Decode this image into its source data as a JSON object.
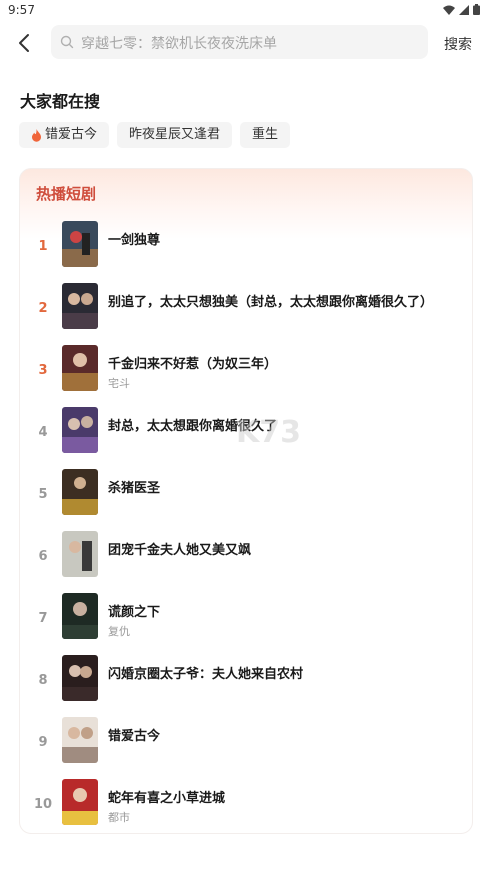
{
  "status_bar": {
    "time": "9:57"
  },
  "search": {
    "back_icon": "back-arrow-icon",
    "placeholder": "穿越七零：禁欲机长夜夜洗床单",
    "button_label": "搜索"
  },
  "trending": {
    "title": "大家都在搜",
    "tags": [
      {
        "label": "错爱古今",
        "hot": true
      },
      {
        "label": "昨夜星辰又逢君",
        "hot": false
      },
      {
        "label": "重生",
        "hot": false
      }
    ]
  },
  "hot_dramas": {
    "title": "热播短剧",
    "accent_color": "#cf4d3c",
    "items": [
      {
        "rank": "1",
        "title": "一剑独尊",
        "subtitle": ""
      },
      {
        "rank": "2",
        "title": "别追了，太太只想独美（封总，太太想跟你离婚很久了）",
        "subtitle": ""
      },
      {
        "rank": "3",
        "title": "千金归来不好惹（为奴三年）",
        "subtitle": "宅斗"
      },
      {
        "rank": "4",
        "title": "封总，太太想跟你离婚很久了",
        "subtitle": ""
      },
      {
        "rank": "5",
        "title": "杀猪医圣",
        "subtitle": ""
      },
      {
        "rank": "6",
        "title": "团宠千金夫人她又美又飒",
        "subtitle": ""
      },
      {
        "rank": "7",
        "title": "谎颜之下",
        "subtitle": "复仇"
      },
      {
        "rank": "8",
        "title": "闪婚京圈太子爷：夫人她来自农村",
        "subtitle": ""
      },
      {
        "rank": "9",
        "title": "错爱古今",
        "subtitle": ""
      },
      {
        "rank": "10",
        "title": "蛇年有喜之小草进城",
        "subtitle": "都市"
      }
    ]
  }
}
